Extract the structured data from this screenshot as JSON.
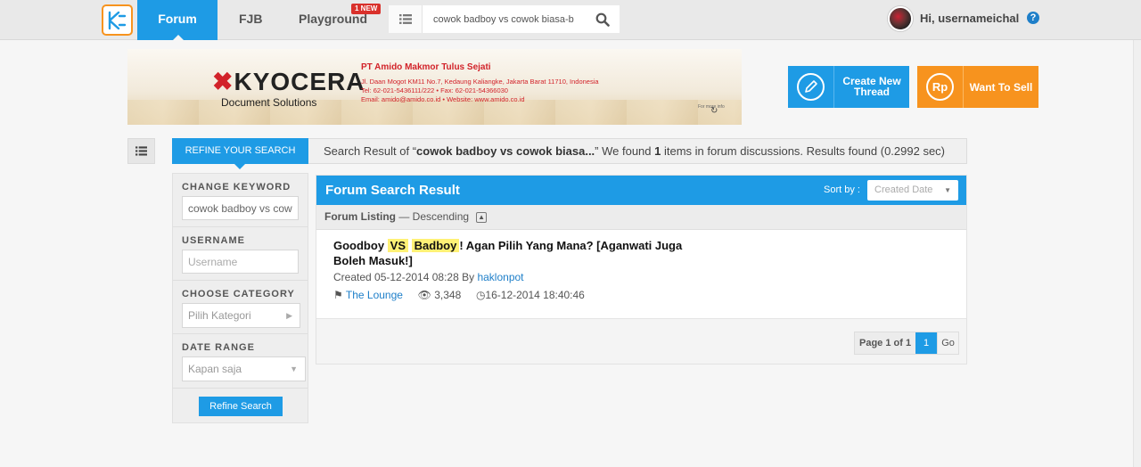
{
  "nav": {
    "forum": "Forum",
    "fjb": "FJB",
    "playground": "Playground",
    "new_badge": "1 NEW",
    "search_value": "cowok badboy vs cowok biasa-b",
    "greeting": "Hi, usernameichal",
    "help": "?"
  },
  "banner": {
    "brand": "KYOCERA",
    "division": "Document Solutions",
    "company": "PT Amido Makmor Tulus Sejati",
    "address": "Jl. Daan Mogot KM11 No.7, Kedaung Kaliangke, Jakarta Barat 11710, Indonesia",
    "phone": "Tel: 62-021-5436111/222  •  Fax: 62-021-54366030",
    "contact": "Email: amido@amido.co.id  •  Website: www.amido.co.id",
    "more": "For more info"
  },
  "actions": {
    "create_line1": "Create New",
    "create_line2": "Thread",
    "sell": "Want To Sell",
    "sell_icon_text": "Rp"
  },
  "refine": {
    "tab": "REFINE YOUR SEARCH",
    "info_prefix": "Search Result of “",
    "info_query": "cowok badboy vs cowok biasa...",
    "info_mid": "” We found ",
    "info_count": "1",
    "info_suffix": " items in forum discussions. Results found (0.2992 sec)"
  },
  "filters": {
    "keyword_label": "CHANGE KEYWORD",
    "keyword_value": "cowok badboy vs cowok biasa-badboy",
    "username_label": "USERNAME",
    "username_placeholder": "Username",
    "category_label": "CHOOSE CATEGORY",
    "category_value": "Pilih Kategori",
    "date_label": "DATE RANGE",
    "date_value": "Kapan saja",
    "submit": "Refine Search"
  },
  "results": {
    "title": "Forum Search Result",
    "sort_label": "Sort by :",
    "sort_value": "Created Date",
    "listing_label": "Forum Listing",
    "listing_order": " — Descending",
    "thread": {
      "title_pre": "Goodboy ",
      "hl1": "VS",
      "hl2": "Badboy",
      "title_post": "! Agan Pilih Yang Mana? [Aganwati Juga Boleh Masuk!]",
      "created_prefix": "Created 05-12-2014 08:28 By ",
      "author": "haklonpot",
      "category": "The Lounge",
      "views": "3,348",
      "last_post": "16-12-2014 18:40:46"
    },
    "pager": {
      "info": "Page 1 of 1",
      "current": "1",
      "go": "Go"
    }
  },
  "colors": {
    "primary": "#1e9be5",
    "accent": "#f7931e",
    "highlight": "#fff176"
  }
}
